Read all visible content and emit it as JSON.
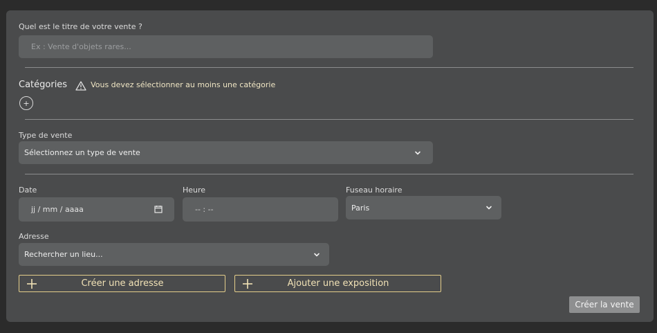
{
  "title_field": {
    "label": "Quel est le titre de votre vente ?",
    "placeholder": "Ex : Vente d'objets rares..."
  },
  "categories": {
    "label": "Catégories",
    "warning": "Vous devez sélectionner au moins une catégorie",
    "add_symbol": "+"
  },
  "sale_type": {
    "label": "Type de vente",
    "value": "Sélectionnez un type de vente"
  },
  "date": {
    "label": "Date",
    "placeholder": "jj / mm / aaaa"
  },
  "time": {
    "label": "Heure",
    "placeholder": "-- : --"
  },
  "timezone": {
    "label": "Fuseau horaire",
    "value": "Paris"
  },
  "address": {
    "label": "Adresse",
    "value": "Rechercher un lieu..."
  },
  "buttons": {
    "create_address": "Créer une adresse",
    "add_exhibition": "Ajouter une exposition",
    "create_sale": "Créer la vente"
  },
  "colors": {
    "panel": "#4a4b4c",
    "field": "#5e6061",
    "accent_outline": "#e5cf8b",
    "submit_bg": "#8e8f90"
  }
}
